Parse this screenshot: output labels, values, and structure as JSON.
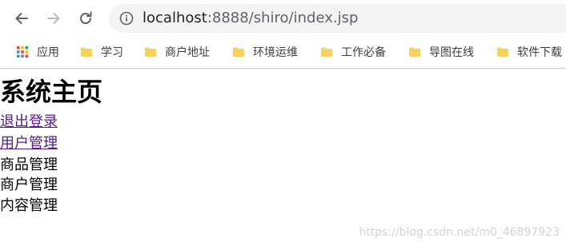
{
  "browser": {
    "url_host": "localhost",
    "url_rest": ":8888/shiro/index.jsp",
    "bookmarks": [
      {
        "label": "应用",
        "icon": "apps-grid-icon"
      },
      {
        "label": "学习",
        "icon": "folder-icon"
      },
      {
        "label": "商户地址",
        "icon": "folder-icon"
      },
      {
        "label": "环境运维",
        "icon": "folder-icon"
      },
      {
        "label": "工作必备",
        "icon": "folder-icon"
      },
      {
        "label": "导图在线",
        "icon": "folder-icon"
      },
      {
        "label": "软件下载",
        "icon": "folder-icon"
      }
    ],
    "folder_color": "#f6d35e"
  },
  "page": {
    "title": "系统主页",
    "links": [
      {
        "label": "退出登录"
      },
      {
        "label": "用户管理"
      }
    ],
    "items": [
      {
        "label": "商品管理"
      },
      {
        "label": "商户管理"
      },
      {
        "label": "内容管理"
      }
    ],
    "link_color": "#551a8b"
  },
  "watermark": "https://blog.csdn.net/m0_46897923"
}
